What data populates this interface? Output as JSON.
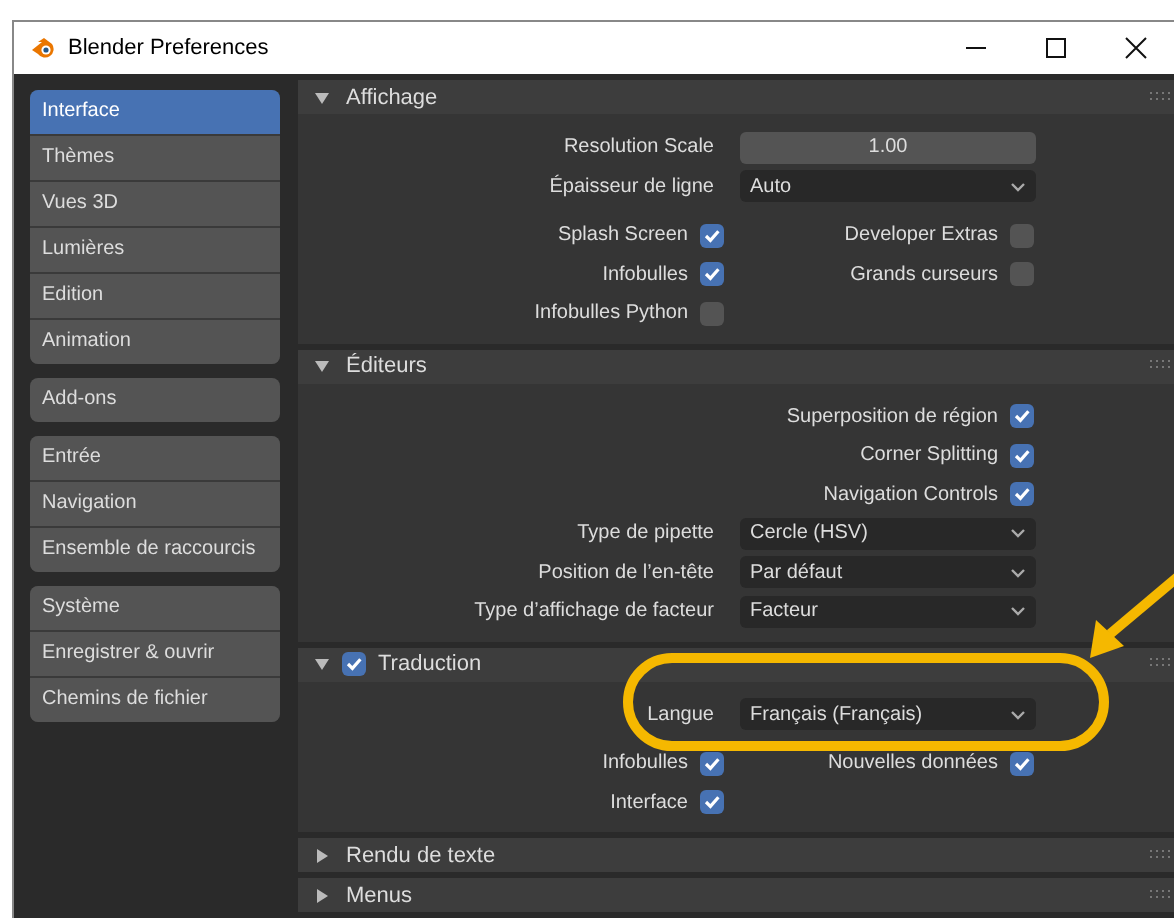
{
  "window": {
    "title": "Blender Preferences"
  },
  "sidebar": {
    "groups": [
      [
        {
          "label": "Interface",
          "selected": true
        },
        {
          "label": "Thèmes",
          "selected": false
        },
        {
          "label": "Vues 3D",
          "selected": false
        },
        {
          "label": "Lumières",
          "selected": false
        },
        {
          "label": "Edition",
          "selected": false
        },
        {
          "label": "Animation",
          "selected": false
        }
      ],
      [
        {
          "label": "Add-ons",
          "selected": false
        }
      ],
      [
        {
          "label": "Entrée",
          "selected": false
        },
        {
          "label": "Navigation",
          "selected": false
        },
        {
          "label": "Ensemble de raccourcis",
          "selected": false
        }
      ],
      [
        {
          "label": "Système",
          "selected": false
        },
        {
          "label": "Enregistrer & ouvrir",
          "selected": false
        },
        {
          "label": "Chemins de fichier",
          "selected": false
        }
      ]
    ]
  },
  "panels": [
    {
      "title": "Affichage",
      "expanded": true,
      "rows": [
        {
          "kind": "number",
          "label": "Resolution Scale",
          "value": "1.00"
        },
        {
          "kind": "dropdown",
          "label": "Épaisseur de ligne",
          "value": "Auto"
        },
        {
          "kind": "checks",
          "left": {
            "label": "Splash Screen",
            "checked": true
          },
          "right": {
            "label": "Developer Extras",
            "checked": false
          }
        },
        {
          "kind": "checks",
          "left": {
            "label": "Infobulles",
            "checked": true
          },
          "right": {
            "label": "Grands curseurs",
            "checked": false
          }
        },
        {
          "kind": "checks",
          "left": {
            "label": "Infobulles Python",
            "checked": false
          }
        }
      ]
    },
    {
      "title": "Éditeurs",
      "expanded": true,
      "rows": [
        {
          "kind": "checks",
          "right": {
            "label": "Superposition de région",
            "checked": true
          }
        },
        {
          "kind": "checks",
          "right": {
            "label": "Corner Splitting",
            "checked": true
          }
        },
        {
          "kind": "checks",
          "right": {
            "label": "Navigation Controls",
            "checked": true
          }
        },
        {
          "kind": "dropdown",
          "label": "Type de pipette",
          "value": "Cercle (HSV)"
        },
        {
          "kind": "dropdown",
          "label": "Position de l’en-tête",
          "value": "Par défaut"
        },
        {
          "kind": "dropdown",
          "label": "Type d’affichage de facteur",
          "value": "Facteur"
        }
      ]
    },
    {
      "title": "Traduction",
      "expanded": true,
      "checked": true,
      "rows": [
        {
          "kind": "dropdown",
          "label": "Langue",
          "value": "Français (Français)"
        },
        {
          "kind": "checks",
          "left": {
            "label": "Infobulles",
            "checked": true
          },
          "right": {
            "label": "Nouvelles données",
            "checked": true
          }
        },
        {
          "kind": "checks",
          "left": {
            "label": "Interface",
            "checked": true
          }
        }
      ]
    },
    {
      "title": "Rendu de texte",
      "expanded": false
    },
    {
      "title": "Menus",
      "expanded": false
    }
  ]
}
